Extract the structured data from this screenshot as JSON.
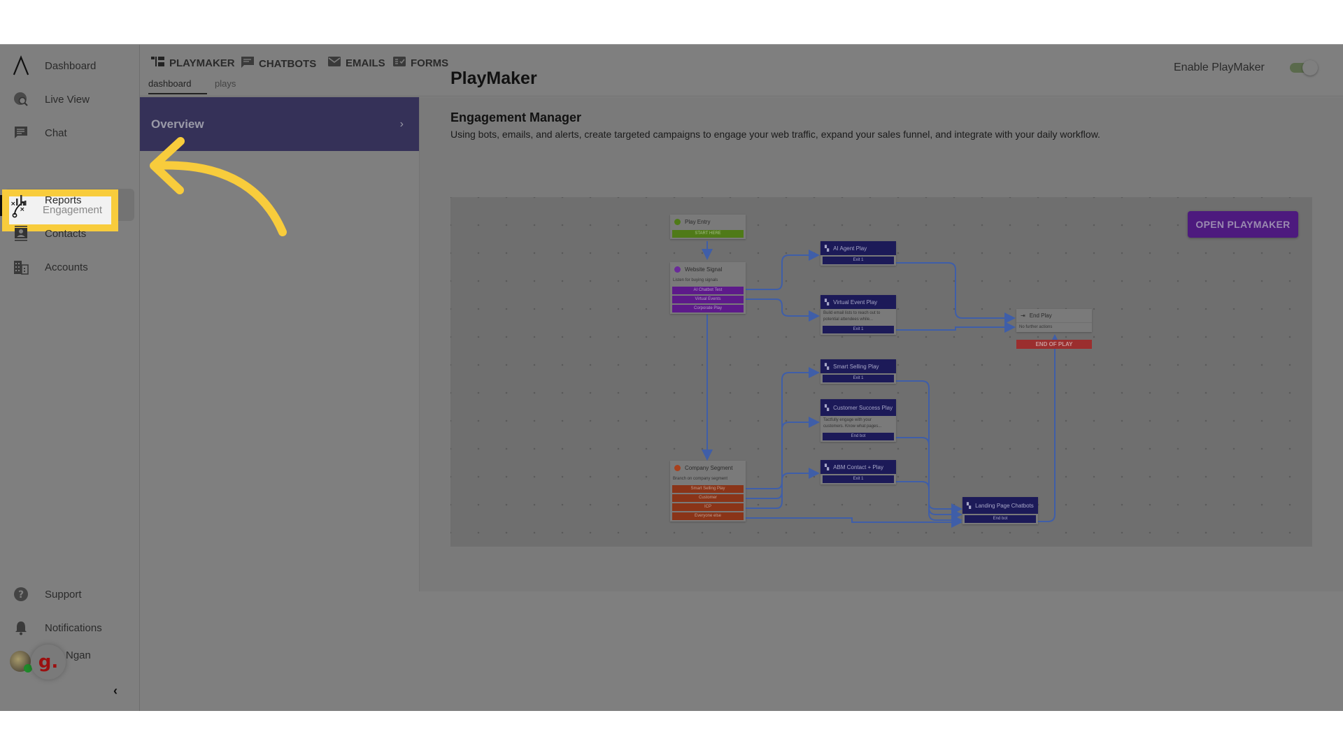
{
  "sidebar": {
    "items": [
      {
        "label": "Dashboard",
        "icon": "app-logo-icon"
      },
      {
        "label": "Live View",
        "icon": "live-view-icon"
      },
      {
        "label": "Chat",
        "icon": "chat-icon"
      },
      {
        "label": "Engagement",
        "icon": "engagement-icon",
        "active": true
      },
      {
        "label": "Reports",
        "icon": "reports-icon"
      },
      {
        "label": "Contacts",
        "icon": "contacts-icon"
      },
      {
        "label": "Accounts",
        "icon": "accounts-icon"
      }
    ],
    "bottom_items": [
      {
        "label": "Support",
        "icon": "help-icon"
      },
      {
        "label": "Notifications",
        "icon": "bell-icon"
      }
    ],
    "user": {
      "name": "Ngan",
      "badge_letter": "g."
    },
    "collapse_glyph": "‹"
  },
  "topbar": {
    "tools": [
      {
        "label": "PLAYMAKER",
        "icon": "playmaker-icon"
      },
      {
        "label": "CHATBOTS",
        "icon": "chatbots-icon"
      },
      {
        "label": "EMAILS",
        "icon": "emails-icon"
      },
      {
        "label": "FORMS",
        "icon": "forms-icon"
      }
    ],
    "subtabs": [
      {
        "label": "dashboard",
        "active": true
      },
      {
        "label": "plays",
        "active": false
      }
    ],
    "enable_label": "Enable PlayMaker",
    "enabled": true
  },
  "subpanel": {
    "overview_label": "Overview",
    "chevron": "›"
  },
  "main": {
    "title": "PlayMaker",
    "section_title": "Engagement Manager",
    "section_desc": "Using bots, emails, and alerts, create targeted campaigns to engage your web traffic, expand your sales funnel, and integrate with your daily workflow.",
    "open_button": "OPEN PLAYMAKER",
    "flow": {
      "play_entry": {
        "title": "Play Entry",
        "exit": "START HERE"
      },
      "website_signal": {
        "title": "Website Signal",
        "desc": "Listen for buying signals",
        "exits": [
          "AI Chatbot Test",
          "Virtual Events",
          "Corporate Play"
        ]
      },
      "company_segment": {
        "title": "Company Segment",
        "desc": "Branch on company segment",
        "exits": [
          "Smart Selling Play",
          "Customer",
          "ICP",
          "Everyone else"
        ]
      },
      "ai_agent_play": {
        "title": "AI Agent Play",
        "exit": "Exit 1"
      },
      "virtual_event_play": {
        "title": "Virtual Event Play",
        "desc": "Build email lists to reach out to potential attendees while...",
        "exit": "Exit 1"
      },
      "smart_selling_play": {
        "title": "Smart Selling Play",
        "exit": "Exit 1"
      },
      "customer_success_play": {
        "title": "Customer Success Play",
        "desc": "Tactfully engage with your customers. Know what pages...",
        "exit": "End bot"
      },
      "abm_contact_play": {
        "title": "ABM Contact + Play",
        "exit": "Exit 1"
      },
      "landing_page_chatbots": {
        "title": "Landing Page Chatbots",
        "exit": "End bot"
      },
      "end_play": {
        "title": "End Play",
        "desc": "No further actions",
        "strip": "END OF PLAY"
      }
    }
  },
  "colors": {
    "highlight": "#f8cc3c",
    "overview_bg": "#353158",
    "open_button": "#4d1a7e",
    "node_dark": "#1c1a58",
    "edge": "#3f5ea8"
  }
}
